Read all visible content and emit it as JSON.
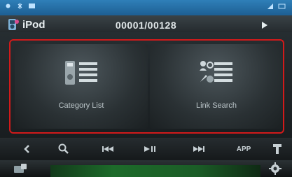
{
  "header": {
    "app_name": "iPod",
    "track_counter": "00001/00128",
    "app_icon": "ipod-icon",
    "play_icon": "play-indicator-icon"
  },
  "main": {
    "tiles": [
      {
        "label": "Category List",
        "icon": "category-list-icon"
      },
      {
        "label": "Link Search",
        "icon": "link-search-icon"
      }
    ],
    "frame_color": "#d21a1a"
  },
  "toolbar": {
    "back_icon": "back-icon",
    "search_icon": "search-icon",
    "prev_icon": "previous-track-icon",
    "playpause_icon": "play-pause-icon",
    "next_icon": "next-track-icon",
    "app_label": "APP",
    "menu_icon": "menu-icon"
  },
  "colors": {
    "status_bar": "#2f7fb8",
    "accent_green": "#1d6b2a"
  }
}
